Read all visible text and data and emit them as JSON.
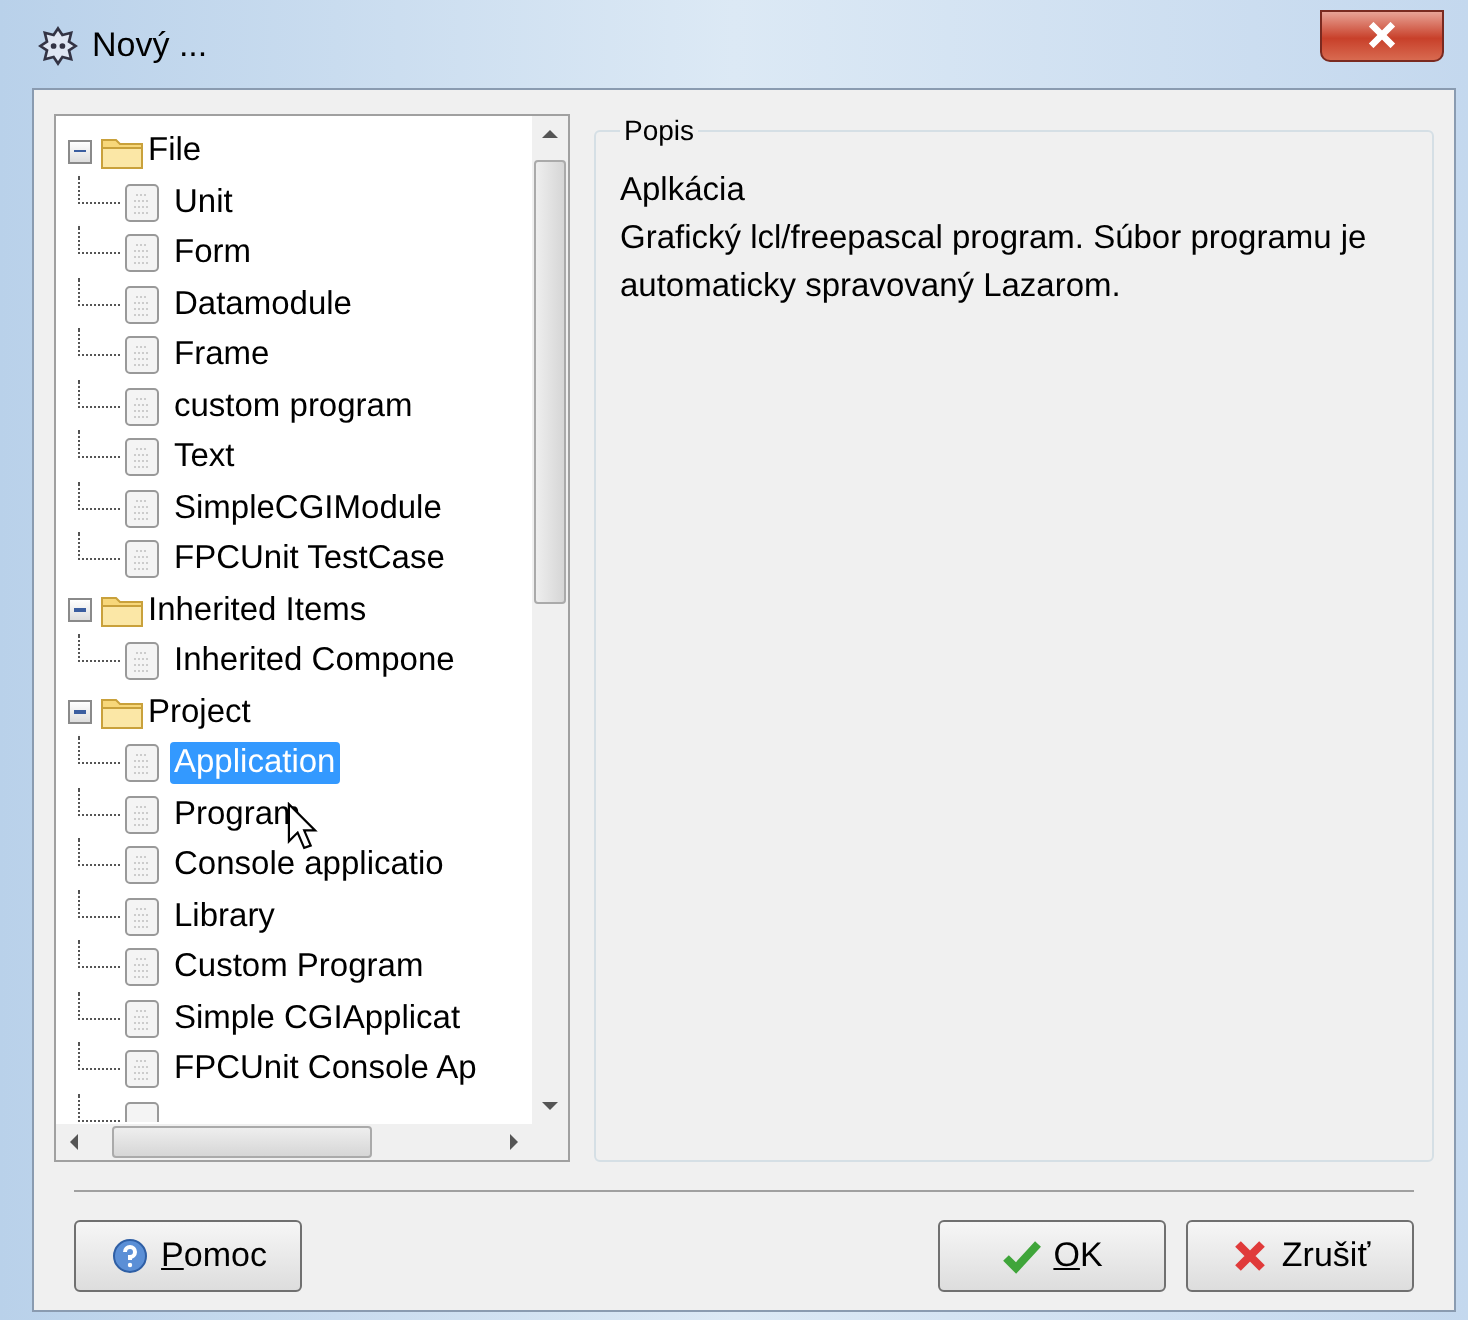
{
  "window": {
    "title": "Nový ..."
  },
  "tree": [
    {
      "label": "File",
      "expanded": true,
      "children": [
        {
          "label": "Unit",
          "selected": false
        },
        {
          "label": "Form",
          "selected": false
        },
        {
          "label": "Datamodule",
          "selected": false
        },
        {
          "label": "Frame",
          "selected": false
        },
        {
          "label": "custom program",
          "selected": false
        },
        {
          "label": "Text",
          "selected": false
        },
        {
          "label": "SimpleCGIModule",
          "selected": false
        },
        {
          "label": "FPCUnit TestCase",
          "selected": false
        }
      ]
    },
    {
      "label": "Inherited Items",
      "expanded": true,
      "children": [
        {
          "label": "Inherited Compone",
          "selected": false
        }
      ]
    },
    {
      "label": "Project",
      "expanded": true,
      "children": [
        {
          "label": "Application",
          "selected": true
        },
        {
          "label": "Program",
          "selected": false
        },
        {
          "label": "Console applicatio",
          "selected": false
        },
        {
          "label": "Library",
          "selected": false
        },
        {
          "label": "Custom Program",
          "selected": false
        },
        {
          "label": "Simple CGIApplicat",
          "selected": false
        },
        {
          "label": "FPCUnit Console Ap",
          "selected": false
        }
      ]
    }
  ],
  "description": {
    "title": "Popis",
    "heading": "Aplkácia",
    "text": "Grafický lcl/freepascal program. Súbor programu je automaticky spravovaný Lazarom."
  },
  "buttons": [
    {
      "kind": "help",
      "accel": "P",
      "rest": "omoc"
    },
    {
      "kind": "ok",
      "accel": "O",
      "rest": "K"
    },
    {
      "kind": "cancel",
      "rest": "Zrušiť"
    }
  ]
}
